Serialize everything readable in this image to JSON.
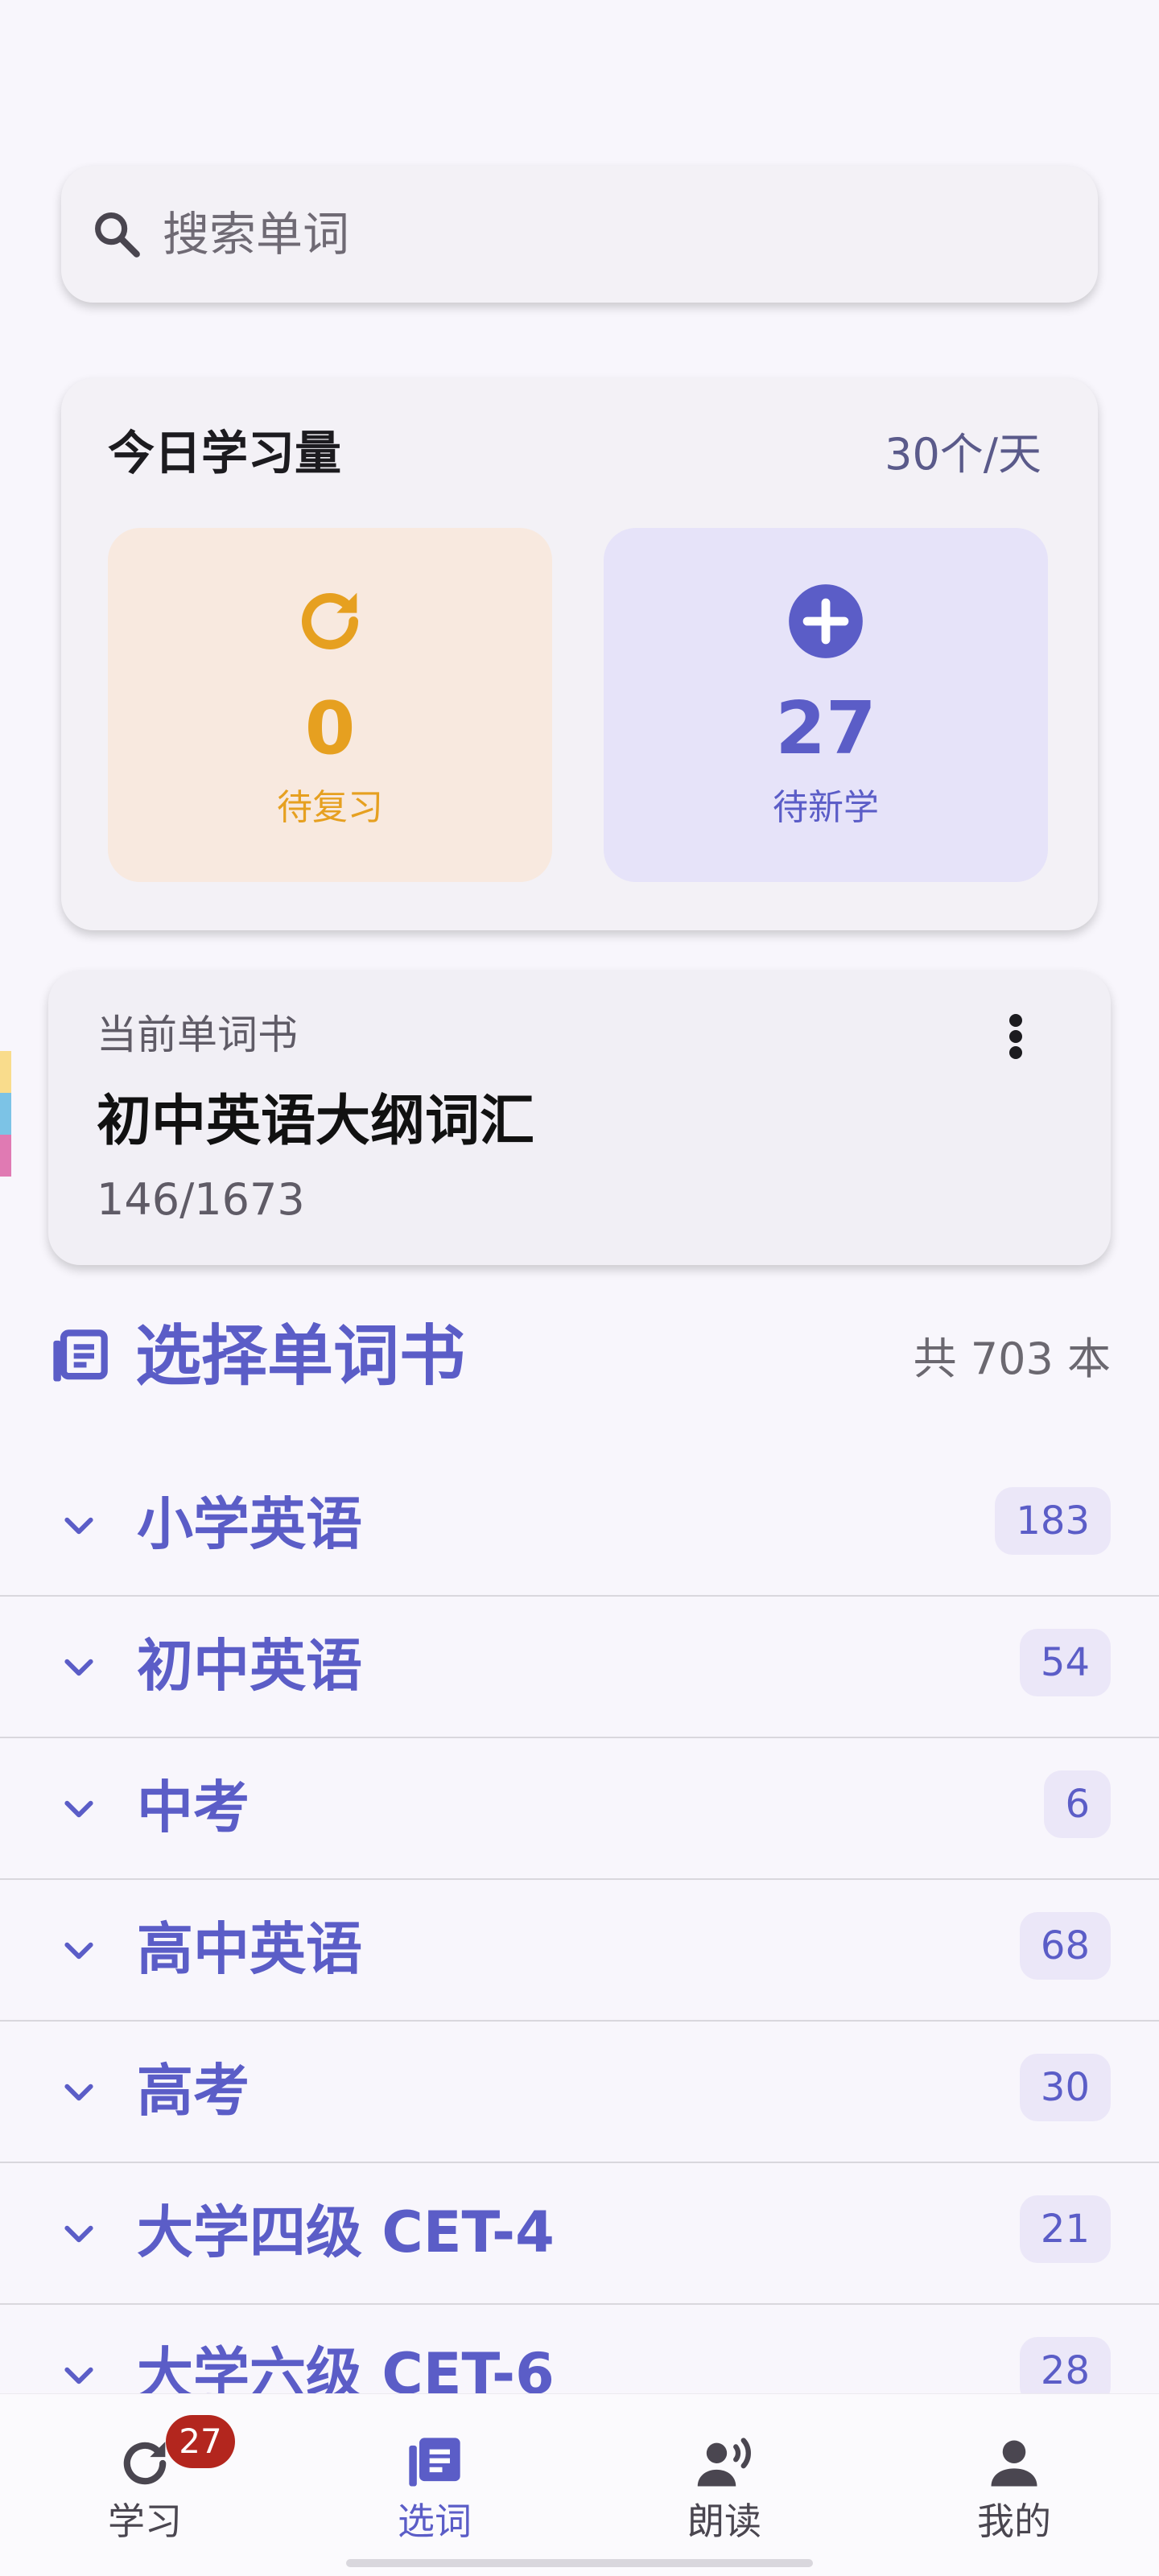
{
  "search": {
    "placeholder": "搜索单词",
    "icon": "search-icon"
  },
  "today": {
    "title": "今日学习量",
    "rate": "30个/天",
    "review": {
      "count": "0",
      "label": "待复习",
      "icon": "refresh-icon",
      "color": "#e6a020"
    },
    "new": {
      "count": "27",
      "label": "待新学",
      "icon": "plus-circle-icon",
      "color": "#5b5dc7"
    }
  },
  "current_book": {
    "caption": "当前单词书",
    "name": "初中英语大纲词汇",
    "progress": "146/1673",
    "menu_icon": "more-vert-icon"
  },
  "section": {
    "title": "选择单词书",
    "count": "共 703 本",
    "icon": "book-icon"
  },
  "categories": [
    {
      "label": "小学英语",
      "count": "183"
    },
    {
      "label": "初中英语",
      "count": "54"
    },
    {
      "label": "中考",
      "count": "6"
    },
    {
      "label": "高中英语",
      "count": "68"
    },
    {
      "label": "高考",
      "count": "30"
    },
    {
      "label": "大学四级 CET-4",
      "count": "21"
    },
    {
      "label": "大学六级 CET-6",
      "count": "28"
    }
  ],
  "nav": {
    "items": [
      {
        "label": "学习",
        "icon": "refresh-icon",
        "badge": "27"
      },
      {
        "label": "选词",
        "icon": "book-icon",
        "active": true
      },
      {
        "label": "朗读",
        "icon": "voice-icon"
      },
      {
        "label": "我的",
        "icon": "person-icon"
      }
    ]
  },
  "colors": {
    "accent": "#5b5dc7",
    "review": "#e6a020",
    "badge": "#b3261e"
  }
}
